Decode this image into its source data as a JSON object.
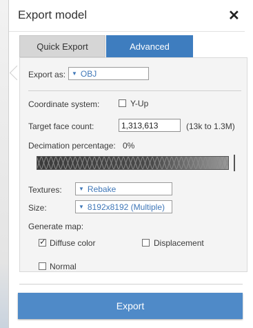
{
  "dialog": {
    "title": "Export model",
    "close_label": "✕"
  },
  "tabs": [
    {
      "label": "Quick Export"
    },
    {
      "label": "Advanced"
    }
  ],
  "advanced": {
    "export_as": {
      "label": "Export as:",
      "value": "OBJ"
    },
    "coordinate_system": {
      "label": "Coordinate system:",
      "checkbox_label": "Y-Up",
      "checked": false
    },
    "target_face_count": {
      "label": "Target face count:",
      "value": "1,313,613",
      "hint": "(13k to 1.3M)"
    },
    "decimation": {
      "label": "Decimation percentage:",
      "value": "0%",
      "level": 0
    },
    "textures": {
      "label": "Textures:",
      "value": "Rebake"
    },
    "size": {
      "label": "Size:",
      "value": "8192x8192 (Multiple)"
    },
    "generate_map": {
      "label": "Generate map:",
      "items": [
        {
          "label": "Diffuse color",
          "checked": true
        },
        {
          "label": "Displacement",
          "checked": false
        },
        {
          "label": "Normal",
          "checked": false
        }
      ]
    }
  },
  "export_button": {
    "label": "Export"
  },
  "colors": {
    "accent": "#3e7dbf",
    "button": "#4f8ac8",
    "link_text": "#3f77b8"
  }
}
